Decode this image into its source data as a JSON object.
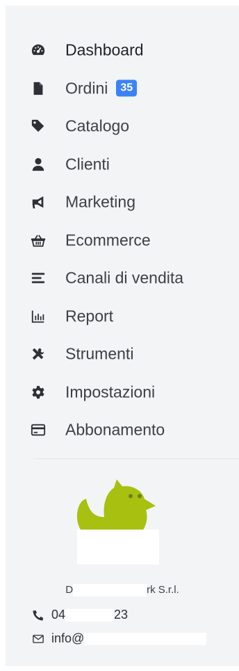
{
  "nav": {
    "items": [
      {
        "label": "Dashboard",
        "icon": "dashboard-gauge-icon"
      },
      {
        "label": "Ordini",
        "icon": "file-icon",
        "badge": "35"
      },
      {
        "label": "Catalogo",
        "icon": "tag-icon"
      },
      {
        "label": "Clienti",
        "icon": "user-icon"
      },
      {
        "label": "Marketing",
        "icon": "megaphone-icon"
      },
      {
        "label": "Ecommerce",
        "icon": "shopping-basket-icon"
      },
      {
        "label": "Canali di vendita",
        "icon": "align-lines-icon"
      },
      {
        "label": "Report",
        "icon": "bar-chart-icon"
      },
      {
        "label": "Strumenti",
        "icon": "tools-icon"
      },
      {
        "label": "Impostazioni",
        "icon": "gear-icon"
      },
      {
        "label": "Abbonamento",
        "icon": "credit-card-icon"
      }
    ]
  },
  "footer": {
    "company_prefix": "D",
    "company_suffix": "rk S.r.l.",
    "phone_prefix": "04",
    "phone_suffix": "23",
    "email_prefix": "info@"
  },
  "colors": {
    "sidebar_bg": "#f3f4f6",
    "badge_bg": "#3b82f6",
    "logo_green": "#a8c00f",
    "text": "#3c3f45",
    "icon": "#2d3035"
  }
}
